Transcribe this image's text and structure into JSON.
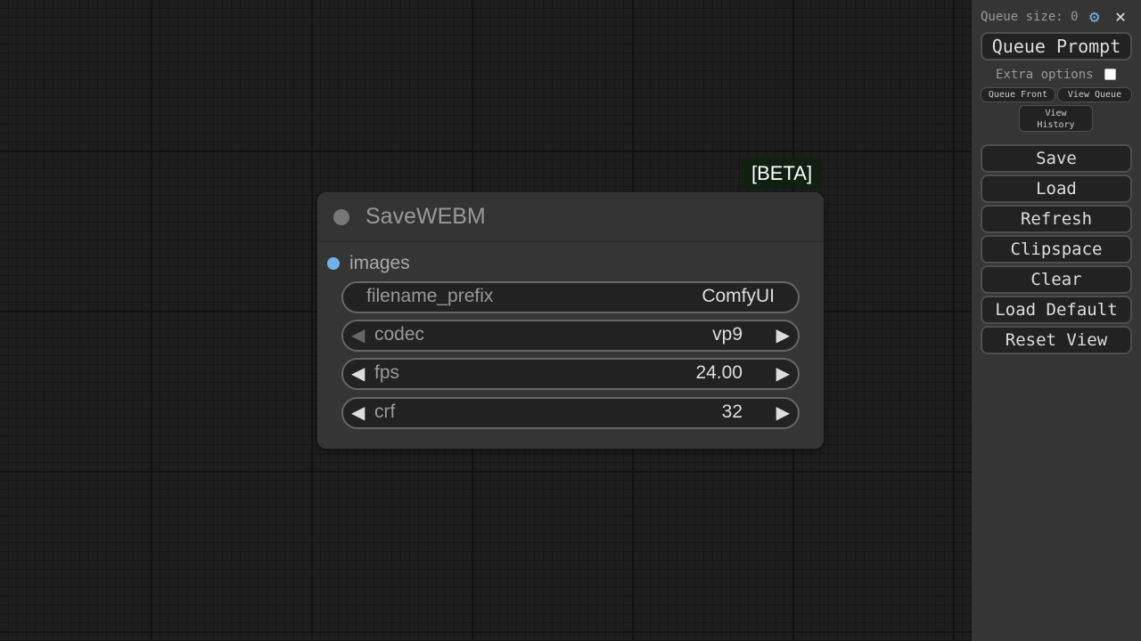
{
  "canvas": {
    "beta_label": "[BETA]",
    "node": {
      "title": "SaveWEBM",
      "input": "images",
      "widgets": [
        {
          "name": "filename_prefix",
          "value": "ComfyUI"
        },
        {
          "name": "codec",
          "value": "vp9"
        },
        {
          "name": "fps",
          "value": "24.00"
        },
        {
          "name": "crf",
          "value": "32"
        }
      ]
    }
  },
  "sidebar": {
    "queue_size_label": "Queue size: 0",
    "queue_prompt": "Queue Prompt",
    "extra_options": "Extra options",
    "queue_front": "Queue Front",
    "view_queue": "View Queue",
    "view_history": "View\nHistory",
    "buttons": [
      "Save",
      "Load",
      "Refresh",
      "Clipspace",
      "Clear",
      "Load Default",
      "Reset View"
    ]
  },
  "icons": {
    "settings": "gear-icon",
    "close": "close-icon",
    "arrow_left": "triangle-left-icon",
    "arrow_right": "triangle-right-icon"
  },
  "colors": {
    "input_slot": "#6fb2ea",
    "beta_bg": "#102010",
    "gear": "#7ab3e8"
  }
}
